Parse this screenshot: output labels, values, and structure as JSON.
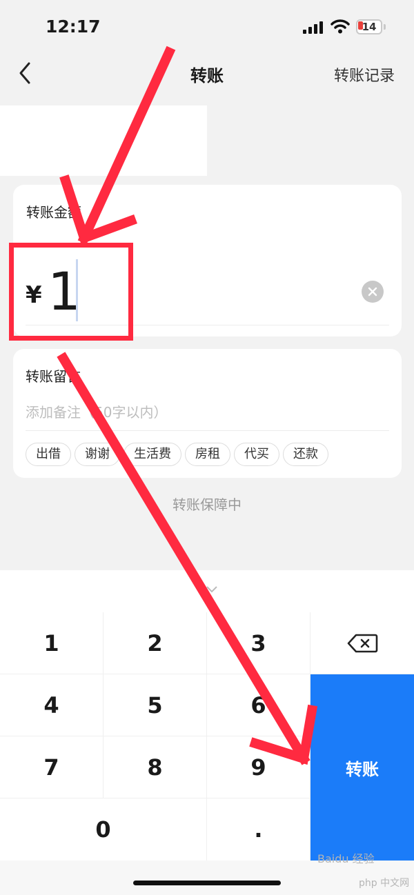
{
  "status_bar": {
    "time": "12:17",
    "battery": "14"
  },
  "nav": {
    "title": "转账",
    "record": "转账记录"
  },
  "amount": {
    "label": "转账金额",
    "currency": "¥",
    "value": "1"
  },
  "message": {
    "label": "转账留言",
    "placeholder": "添加备注（50字以内）",
    "tags": [
      "出借",
      "谢谢",
      "生活费",
      "房租",
      "代买",
      "还款"
    ]
  },
  "protect_text": "转账保障中",
  "keyboard": {
    "keys": [
      "1",
      "2",
      "3",
      "4",
      "5",
      "6",
      "7",
      "8",
      "9",
      "0",
      "."
    ],
    "submit_label": "转账"
  },
  "watermark": {
    "line1": "Baidu 经验",
    "line2": "php 中文网"
  },
  "colors": {
    "accent": "#1b7cf9",
    "annotation": "#ff2a40",
    "background": "#f2f2f2"
  }
}
